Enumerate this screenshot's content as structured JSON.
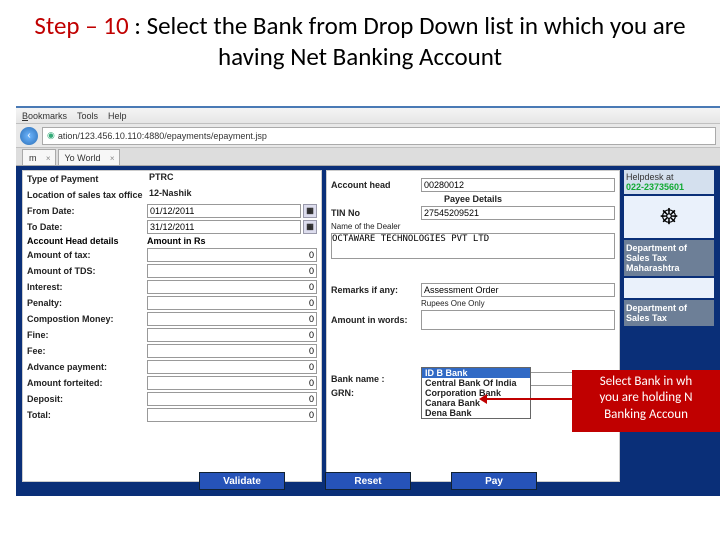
{
  "slide": {
    "step_label": "Step – 10",
    "title_rest": " : Select the Bank from Drop Down list in which you are having Net Banking Account"
  },
  "menubar": {
    "bookmarks": "Bookmarks",
    "tools": "Tools",
    "help": "Help"
  },
  "url": "ation/123.456.10.110:4880/epayments/epayment.jsp",
  "tabs": {
    "t1": "m",
    "t2": "Yo World"
  },
  "left": {
    "type_of_payment": {
      "label": "Type of Payment",
      "value": "PTRC"
    },
    "location": {
      "label": "Location of sales tax office",
      "value": "12-Nashik"
    },
    "from_date": {
      "label": "From Date:",
      "value": "01/12/2011"
    },
    "to_date": {
      "label": "To Date:",
      "value": "31/12/2011"
    },
    "acct_head_details": "Account Head details",
    "amount_in_rs": "Amount in Rs",
    "tax": {
      "label": "Amount of tax:",
      "value": "0"
    },
    "tds": {
      "label": "Amount of TDS:",
      "value": "0"
    },
    "interest": {
      "label": "Interest:",
      "value": "0"
    },
    "penalty": {
      "label": "Penalty:",
      "value": "0"
    },
    "composition": {
      "label": "Compostion Money:",
      "value": "0"
    },
    "fine": {
      "label": "Fine:",
      "value": "0"
    },
    "fee": {
      "label": "Fee:",
      "value": "0"
    },
    "advance": {
      "label": "Advance payment:",
      "value": "0"
    },
    "forfeited": {
      "label": "Amount forteited:",
      "value": "0"
    },
    "deposit": {
      "label": "Deposit:",
      "value": "0"
    },
    "total": {
      "label": "Total:",
      "value": "0"
    }
  },
  "mid": {
    "account_head": {
      "label": "Account head",
      "value": "00280012"
    },
    "payee_details": "Payee Details",
    "tin": {
      "label": "TIN No",
      "value": "27545209521"
    },
    "dealer_name_label": "Name of the Dealer",
    "dealer_name": "OCTAWARE TECHNOLOGIES PVT LTD",
    "remarks": {
      "label": "Remarks if any:",
      "value": "Assessment Order"
    },
    "words_prefix": "Rupees One  Only",
    "amount_words": {
      "label": "Amount in words:"
    },
    "bank_name": {
      "label": "Bank name :"
    },
    "grn": {
      "label": "GRN:"
    }
  },
  "dropdown": {
    "items": [
      "ID B  Bank",
      "Central Bank Of India",
      "Corporation Bank",
      "Canara Bank",
      "Dena Bank"
    ]
  },
  "right": {
    "helpdesk": "Helpdesk at",
    "phone": "022-23735601",
    "dept": "Department of Sales Tax Maharashtra",
    "dept2": "Department of Sales Tax"
  },
  "buttons": {
    "validate": "Validate",
    "reset": "Reset",
    "pay": "Pay"
  },
  "callout": {
    "l1": "Select Bank  in wh",
    "l2": "you are holding N",
    "l3": "Banking Accoun"
  }
}
